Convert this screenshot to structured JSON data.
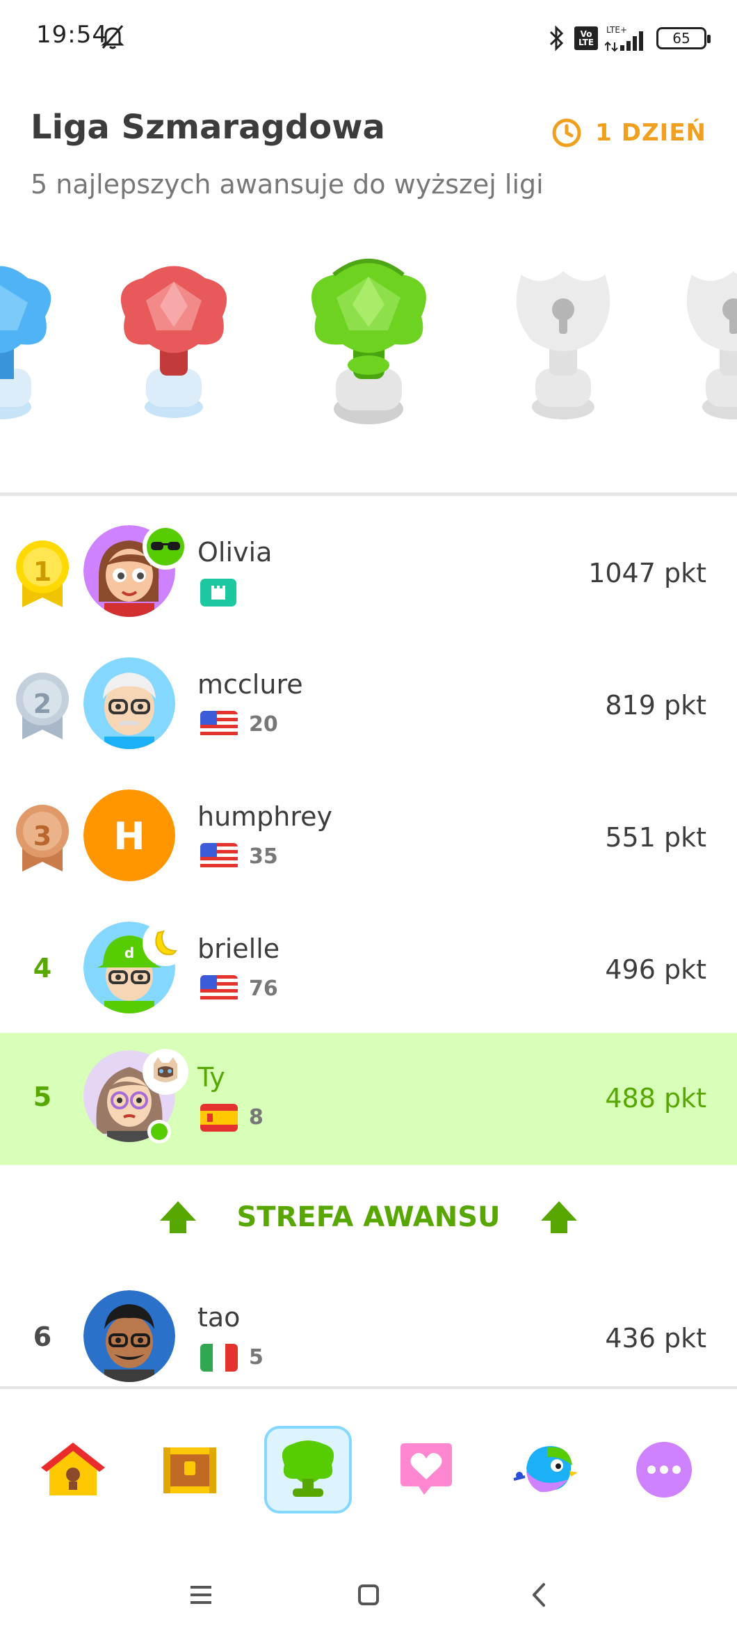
{
  "status_bar": {
    "time": "19:54",
    "volte_line1": "Vo",
    "volte_line2": "LTE",
    "network": "LTE+",
    "battery": "65"
  },
  "header": {
    "league_title": "Liga Szmaragdowa",
    "subtitle": "5 najlepszych awansuje do wyższej ligi",
    "timer_label": "1 DZIEŃ",
    "accent_color": "#f0a01e"
  },
  "leagues": [
    {
      "name": "sapphire",
      "color": "#4fb3f6",
      "state": "passed"
    },
    {
      "name": "ruby",
      "color": "#e85a5a",
      "state": "passed"
    },
    {
      "name": "emerald",
      "color": "#6dd320",
      "state": "current"
    },
    {
      "name": "locked-1",
      "color": "#e5e5e5",
      "state": "locked"
    },
    {
      "name": "locked-2",
      "color": "#e5e5e5",
      "state": "locked"
    }
  ],
  "leaderboard": [
    {
      "rank": "1",
      "name": "Olivia",
      "flag": "league-badge",
      "streak": "",
      "points": "1047 pkt",
      "medal": "gold",
      "avatar": "letter-none"
    },
    {
      "rank": "2",
      "name": "mcclure",
      "flag": "us",
      "streak": "20",
      "points": "819 pkt",
      "medal": "silver"
    },
    {
      "rank": "3",
      "name": "humphrey",
      "flag": "us",
      "streak": "35",
      "points": "551 pkt",
      "medal": "bronze",
      "avatar_letter": "H"
    },
    {
      "rank": "4",
      "name": "brielle",
      "flag": "us",
      "streak": "76",
      "points": "496 pkt"
    },
    {
      "rank": "5",
      "name": "Ty",
      "flag": "es",
      "streak": "8",
      "points": "488 pkt",
      "is_me": true
    },
    {
      "rank": "6",
      "name": "tao",
      "flag": "it",
      "streak": "5",
      "points": "436 pkt"
    }
  ],
  "promotion_zone": {
    "label": "STREFA AWANSU",
    "color": "#58a700"
  },
  "bottom_nav": [
    {
      "icon": "home-icon",
      "label": "Learn"
    },
    {
      "icon": "chest-icon",
      "label": "Shop"
    },
    {
      "icon": "trophy-icon",
      "label": "Leagues",
      "active": true
    },
    {
      "icon": "heart-message-icon",
      "label": "Hearts"
    },
    {
      "icon": "bird-icon",
      "label": "Super"
    },
    {
      "icon": "more-icon",
      "label": "More"
    }
  ]
}
